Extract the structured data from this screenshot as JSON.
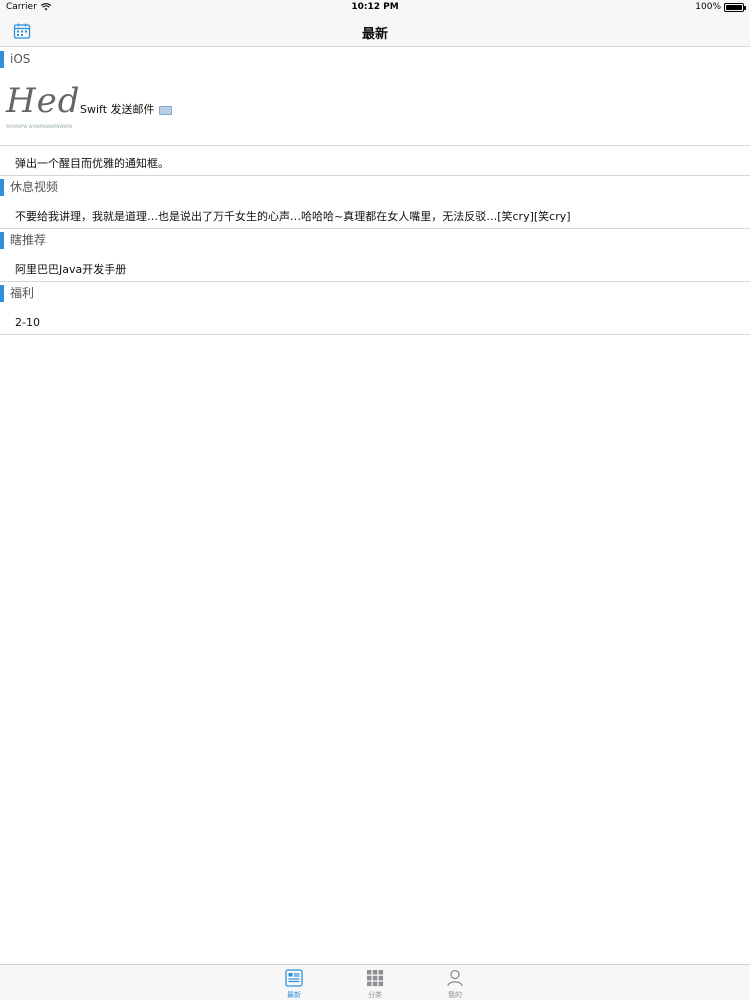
{
  "status_bar": {
    "carrier": "Carrier",
    "time": "10:12 PM",
    "battery": "100%",
    "battery_level": 1.0
  },
  "nav": {
    "title": "最新",
    "left_icon": "calendar-icon"
  },
  "colors": {
    "accent": "#2e8fdc",
    "section_bar": "#2e8fdc",
    "separator": "#d6d6d6",
    "tab_inactive": "#8e8e93"
  },
  "sections": [
    {
      "title": "iOS",
      "items": [
        {
          "thumb_title": "Hed",
          "thumb_sub": "WOWWPW WOWPWWWPNWKPW",
          "text": "Swift 发送邮件"
        },
        {
          "text": "弹出一个醒目而优雅的通知框。"
        }
      ]
    },
    {
      "title": "休息视频",
      "items": [
        {
          "text": "不要给我讲理，我就是道理…也是说出了万千女生的心声…哈哈哈~真理都在女人嘴里，无法反驳…[笑cry][笑cry]"
        }
      ]
    },
    {
      "title": "瞎推荐",
      "items": [
        {
          "text": "阿里巴巴Java开发手册"
        }
      ]
    },
    {
      "title": "福利",
      "items": [
        {
          "text": "2-10"
        }
      ]
    }
  ],
  "tabbar": {
    "tabs": [
      {
        "label": "最新",
        "icon": "news-icon",
        "active": true
      },
      {
        "label": "分类",
        "icon": "grid-icon",
        "active": false
      },
      {
        "label": "我的",
        "icon": "person-icon",
        "active": false
      }
    ]
  }
}
